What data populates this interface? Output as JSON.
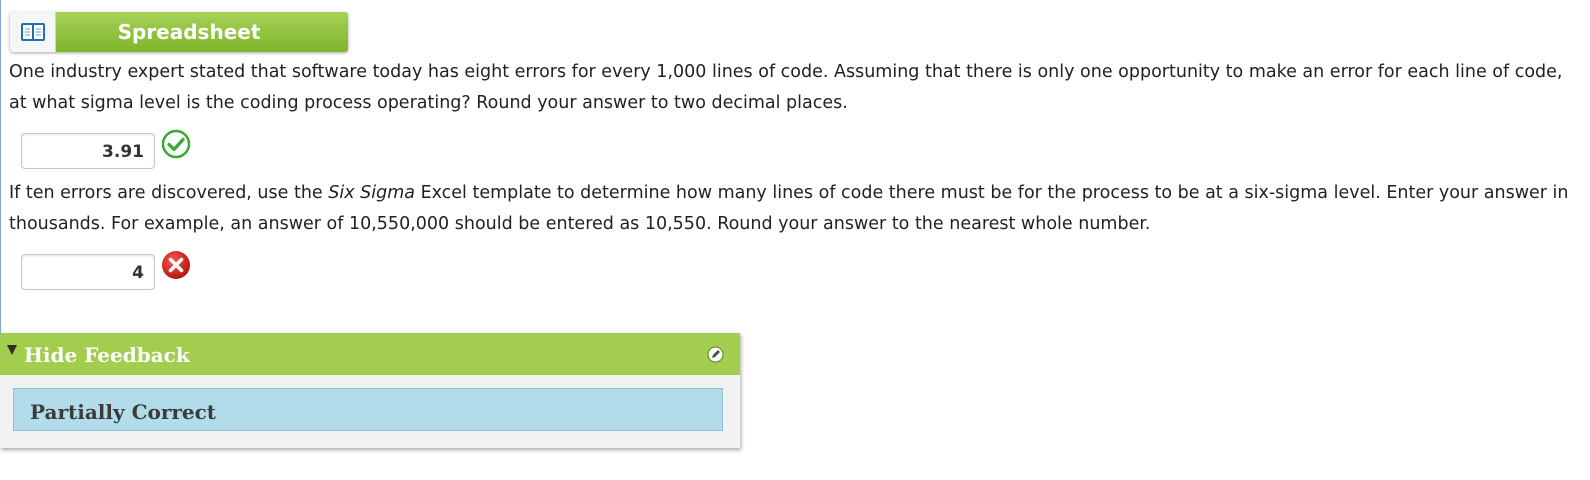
{
  "spreadsheet_button": {
    "label": "Spreadsheet",
    "icon": "book-icon",
    "color": "#8cc63f"
  },
  "question1": {
    "text": "One industry expert stated that software today has eight errors for every 1,000 lines of code. Assuming that there is only one opportunity to make an error for each line of code, at what sigma level is the coding process operating? Round your answer to two decimal places.",
    "answer": "3.91",
    "status": "correct",
    "status_icon": "check-circle-icon",
    "status_color": "#3aa935"
  },
  "question2": {
    "text_before": "If ten errors are discovered, use the ",
    "text_italic": "Six Sigma",
    "text_after": " Excel template to determine how many lines of code there must be for the process to be at a six-sigma level. Enter your answer in thousands. For example, an answer of 10,550,000 should be entered as 10,550. Round your answer to the nearest whole number.",
    "answer": "4",
    "status": "incorrect",
    "status_icon": "x-circle-icon",
    "status_color": "#d0201e"
  },
  "feedback": {
    "toggle_label": "Hide Feedback",
    "result": "Partially Correct",
    "header_color": "#a2cd4e",
    "result_color": "#b3dceb"
  }
}
